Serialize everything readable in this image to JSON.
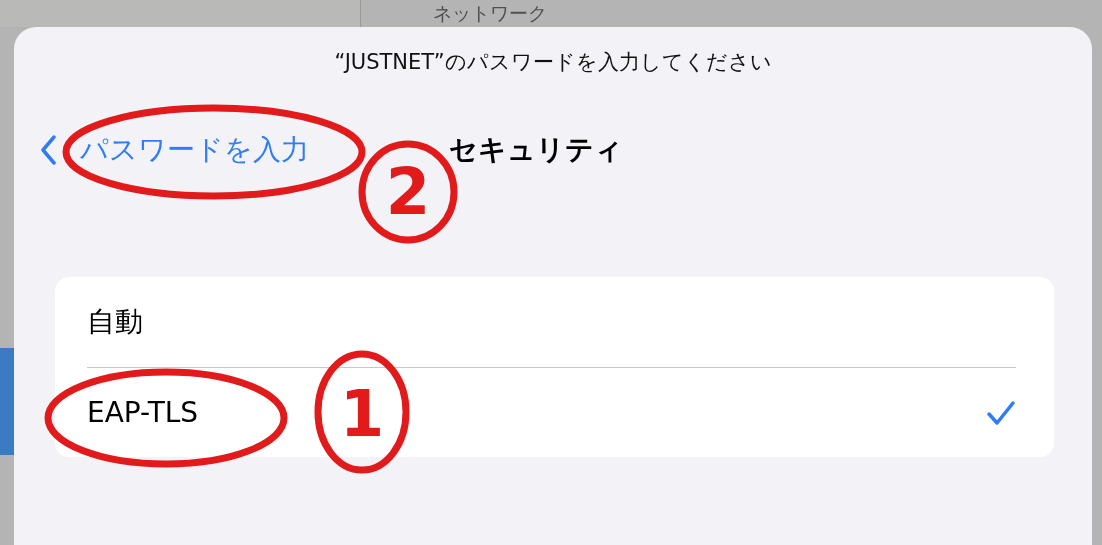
{
  "background": {
    "header": "ネットワーク"
  },
  "sheet": {
    "title": "“JUSTNET”のパスワードを入力してください",
    "back": "パスワードを入力",
    "heading": "セキュリティ",
    "options": [
      {
        "label": "自動",
        "selected": false
      },
      {
        "label": "EAP-TLS",
        "selected": true
      }
    ]
  },
  "annotations": [
    {
      "label": "1"
    },
    {
      "label": "2"
    }
  ]
}
